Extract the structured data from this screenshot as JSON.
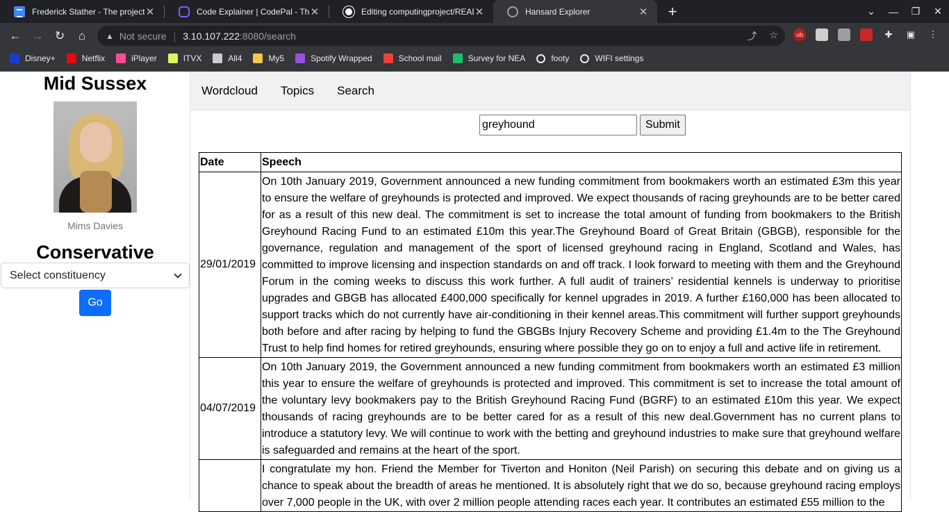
{
  "browser": {
    "tabs": [
      {
        "title": "Frederick Stather - The project - G",
        "icon": "google-docs-icon",
        "active": false
      },
      {
        "title": "Code Explainer | CodePal - The U",
        "icon": "codepal-icon",
        "active": false
      },
      {
        "title": "Editing computingproject/READM",
        "icon": "github-icon",
        "active": false
      },
      {
        "title": "Hansard Explorer",
        "icon": "globe-icon",
        "active": true
      }
    ],
    "address": {
      "security_label": "Not secure",
      "host": "3.10.107.222",
      "path": ":8080/search"
    },
    "bookmarks": [
      {
        "label": "Disney+",
        "icon": "disney-icon",
        "color": "#1a3bd1"
      },
      {
        "label": "Netflix",
        "icon": "netflix-icon",
        "color": "#e50914"
      },
      {
        "label": "iPlayer",
        "icon": "iplayer-icon",
        "color": "#ff4c98"
      },
      {
        "label": "ITVX",
        "icon": "itvx-icon",
        "color": "#d9f75c"
      },
      {
        "label": "All4",
        "icon": "all4-icon",
        "color": "#cccccc"
      },
      {
        "label": "My5",
        "icon": "my5-icon",
        "color": "#f2c94c"
      },
      {
        "label": "Spotify Wrapped",
        "icon": "spotify-icon",
        "color": "#9b51e0"
      },
      {
        "label": "School mail",
        "icon": "gmail-icon",
        "color": "#ea4335"
      },
      {
        "label": "Survey for NEA",
        "icon": "survey-icon",
        "color": "#1fbd6b"
      },
      {
        "label": "footy",
        "icon": "globe-icon",
        "color": "#e8eaed"
      },
      {
        "label": "WIFI settings",
        "icon": "globe-icon",
        "color": "#e8eaed"
      }
    ]
  },
  "sidebar": {
    "constituency": "Mid Sussex",
    "mp_name": "Mims Davies",
    "party": "Conservative",
    "select_label": "Select constituency",
    "go_label": "Go"
  },
  "nav": {
    "links": [
      "Wordcloud",
      "Topics",
      "Search"
    ]
  },
  "search": {
    "query": "greyhound",
    "submit_label": "Submit"
  },
  "results": {
    "headers": {
      "date": "Date",
      "speech": "Speech"
    },
    "rows": [
      {
        "date": "29/01/2019",
        "speech": "On 10th January 2019, Government announced a new funding commitment from bookmakers worth an estimated £3m this year to ensure the welfare of greyhounds is protected and improved. We expect thousands of racing greyhounds are to be better cared for as a result of this new deal. The commitment is set to increase the total amount of funding from bookmakers to the British Greyhound Racing Fund to an estimated £10m this year.The Greyhound Board of Great Britain (GBGB), responsible for the governance, regulation and management of the sport of licensed greyhound racing in England, Scotland and Wales, has committed to improve licensing and inspection standards on and off track. I look forward to meeting with them and the Greyhound Forum in the coming weeks to discuss this work further. A full audit of trainers’ residential kennels is underway to prioritise upgrades and GBGB has allocated £400,000 specifically for kennel upgrades in 2019. A further £160,000 has been allocated to support tracks which do not currently have air-conditioning in their kennel areas.This commitment will further support greyhounds both before and after racing by helping to fund the GBGBs Injury Recovery Scheme and providing £1.4m to the The Greyhound Trust to help find homes for retired greyhounds, ensuring where possible they go on to enjoy a full and active life in retirement."
      },
      {
        "date": "04/07/2019",
        "speech": "On 10th January 2019, the Government announced a new funding commitment from bookmakers worth an estimated £3 million this year to ensure the welfare of greyhounds is protected and improved. This commitment is set to increase the total amount of the voluntary levy bookmakers pay to the British Greyhound Racing Fund (BGRF) to an estimated £10m this year. We expect thousands of racing greyhounds are to be better cared for as a result of this new deal.Government has no current plans to introduce a statutory levy. We will continue to work with the betting and greyhound industries to make sure that greyhound welfare is safeguarded and remains at the heart of the sport."
      },
      {
        "date": "",
        "speech": "I congratulate my hon. Friend the Member for Tiverton and Honiton (Neil Parish) on securing this debate and on giving us a chance to speak about the breadth of areas he mentioned. It is absolutely right that we do so, because greyhound racing employs over 7,000 people in the UK, with over 2 million people attending races each year. It contributes an estimated £55 million to the"
      }
    ]
  }
}
